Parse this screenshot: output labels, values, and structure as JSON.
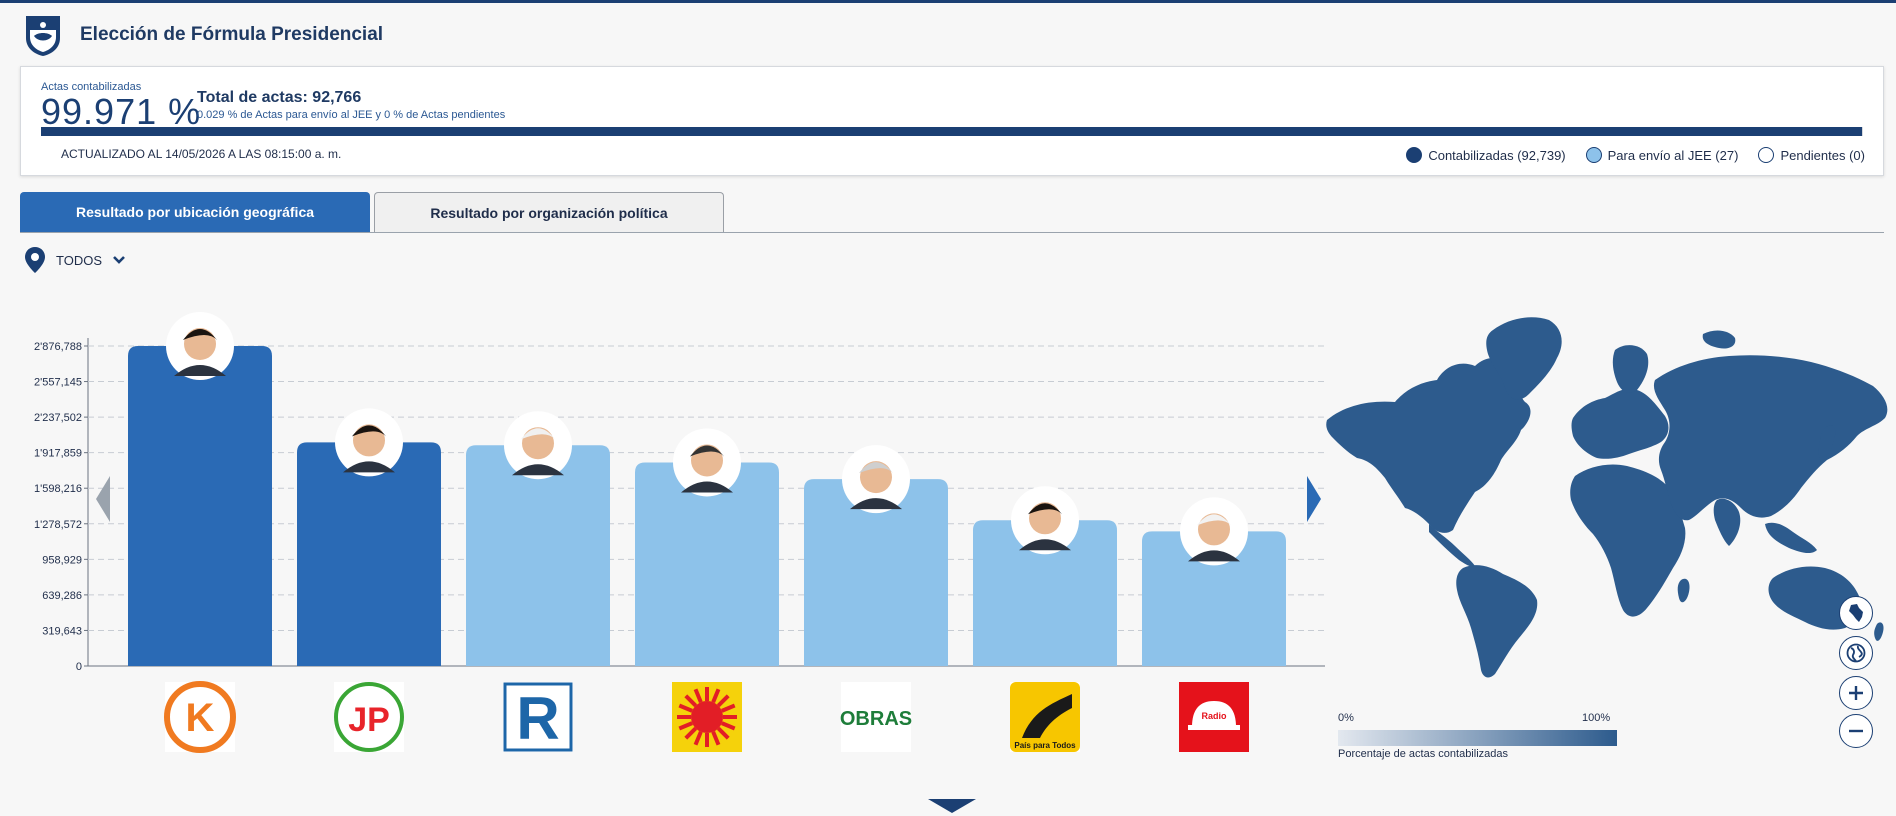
{
  "header": {
    "title": "Elección de Fórmula Presidencial"
  },
  "summary": {
    "actas_label": "Actas contabilizadas",
    "actas_percent": "99.971 %",
    "actas_fraction": 0.99971,
    "total_label": "Total de actas: 92,766",
    "sub_text": "0.029 % de Actas para envío al JEE y 0 % de Actas pendientes",
    "updated": "ACTUALIZADO AL 14/05/2026 A LAS 08:15:00 a. m.",
    "legend": [
      {
        "label": "Contabilizadas (92,739)",
        "color": "#1b3f73"
      },
      {
        "label": "Para envío al JEE (27)",
        "color": "#8dc2ea"
      },
      {
        "label": "Pendientes (0)",
        "color": "#ffffff"
      }
    ]
  },
  "tabs": [
    {
      "label": "Resultado por ubicación geográfica"
    },
    {
      "label": "Resultado por organización política"
    }
  ],
  "filter": {
    "label": "TODOS"
  },
  "colors": {
    "primary": "#2a6ab5",
    "secondary": "#8dc2ea",
    "navy": "#1b3f73"
  },
  "chart_data": {
    "type": "bar",
    "categories": [
      "K",
      "JP",
      "R",
      "Sol",
      "OBRAS",
      "País para Todos",
      "Radio"
    ],
    "values": [
      2876788,
      2010000,
      1985000,
      1830000,
      1680000,
      1310000,
      1210000
    ],
    "bar_colors": [
      "#2a6ab5",
      "#2a6ab5",
      "#8dc2ea",
      "#8dc2ea",
      "#8dc2ea",
      "#8dc2ea",
      "#8dc2ea"
    ],
    "yticks": [
      "0",
      "319,643",
      "639,286",
      "958,929",
      "1'278,572",
      "1'598,216",
      "1'917,859",
      "2'237,502",
      "2'557,145",
      "2'876,788"
    ],
    "ylim": [
      0,
      2876788
    ],
    "grid": true,
    "party_logos": [
      "K",
      "JP",
      "R",
      "sun",
      "OBRAS",
      "País para Todos",
      "Radio"
    ]
  },
  "map": {
    "scale_min": "0%",
    "scale_max": "100%",
    "scale_caption": "Porcentaje de actas contabilizadas",
    "controls": [
      "peru-icon",
      "globe-icon",
      "zoom-in-icon",
      "zoom-out-icon"
    ],
    "fill_color": "#2d5b8d"
  }
}
